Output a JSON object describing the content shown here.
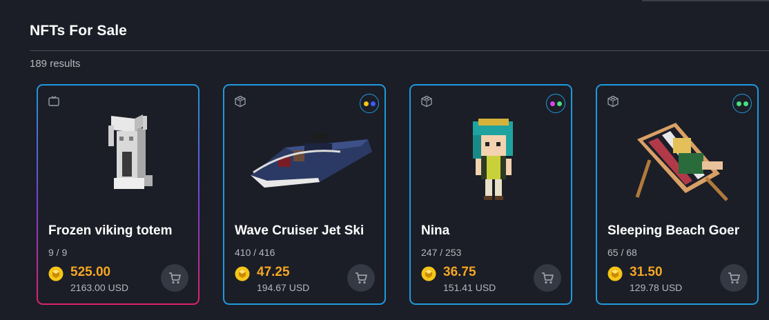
{
  "header": {
    "title": "NFTs For Sale",
    "results": "189 results"
  },
  "cards": [
    {
      "name": "Frozen viking totem",
      "supply": "9 / 9",
      "price": "525.00",
      "usd": "2163.00 USD",
      "type_icon": "tv-icon",
      "dots": []
    },
    {
      "name": "Wave Cruiser Jet Ski",
      "supply": "410 / 416",
      "price": "47.25",
      "usd": "194.67 USD",
      "type_icon": "cube-icon",
      "dots": [
        "#f5c518",
        "#3b5bff"
      ]
    },
    {
      "name": "Nina",
      "supply": "247 / 253",
      "price": "36.75",
      "usd": "151.41 USD",
      "type_icon": "cube-icon",
      "dots": [
        "#d946ef",
        "#4ade80"
      ]
    },
    {
      "name": "Sleeping Beach Goer",
      "supply": "65 / 68",
      "price": "31.50",
      "usd": "129.78 USD",
      "type_icon": "cube-icon",
      "dots": [
        "#4ade80",
        "#4ade80"
      ]
    }
  ],
  "colors": {
    "accent": "#1f9ae0",
    "price": "#f5a623",
    "coin": "#f5c518"
  }
}
